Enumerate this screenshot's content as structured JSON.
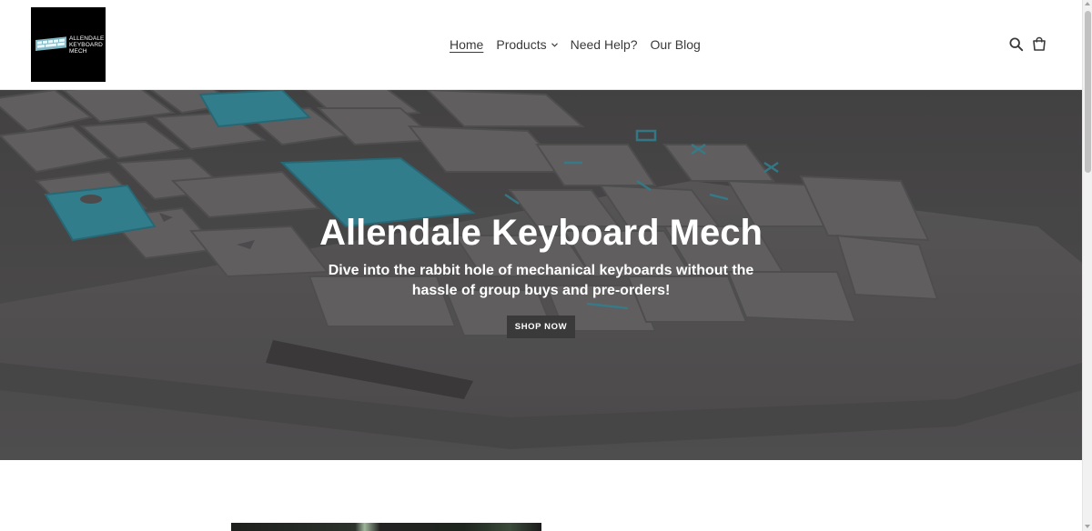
{
  "header": {
    "logo_text": "ALLENDALE KEYBOARD MECH",
    "nav": [
      {
        "label": "Home",
        "active": true
      },
      {
        "label": "Products",
        "has_dropdown": true
      },
      {
        "label": "Need Help?"
      },
      {
        "label": "Our Blog"
      }
    ],
    "icons": [
      "search-icon",
      "cart-icon"
    ]
  },
  "hero": {
    "title": "Allendale Keyboard Mech",
    "subtitle": "Dive into the rabbit hole of mechanical keyboards without the hassle of group buys and pre-orders!",
    "button_label": "SHOP NOW"
  },
  "colors": {
    "text": "#3a3a3a",
    "button_bg": "#3a3a3a",
    "keycap_accent": "#3fb8d0",
    "keycap_grey": "#7d7b7c"
  }
}
